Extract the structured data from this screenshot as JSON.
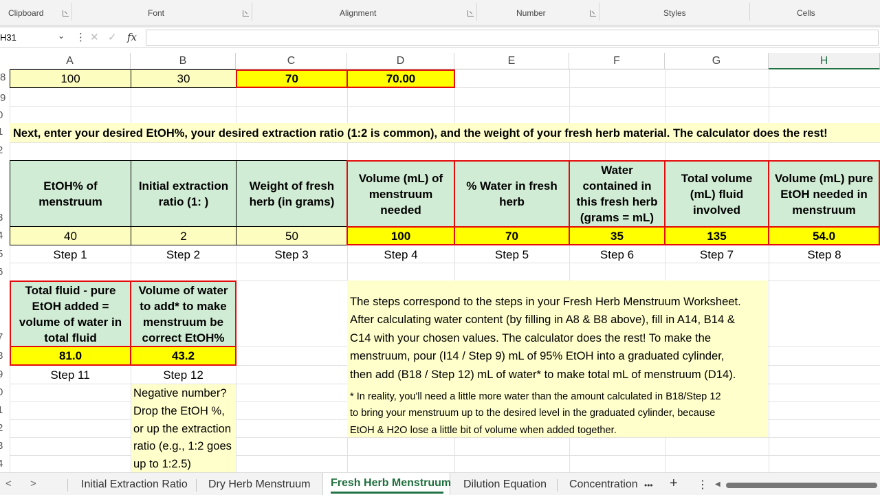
{
  "ribbon": {
    "groups": [
      "Clipboard",
      "Font",
      "Alignment",
      "Number",
      "Styles",
      "Cells"
    ]
  },
  "formula_bar": {
    "name_box": "H31",
    "fx_label": "fx",
    "cancel_glyph": "✕",
    "enter_glyph": "✓",
    "more_glyph": "⋮",
    "chevron": "⌄",
    "formula": ""
  },
  "grid": {
    "columns": [
      "A",
      "B",
      "C",
      "D",
      "E",
      "F",
      "G",
      "H"
    ],
    "selected_column": "H",
    "row_numbers": [
      "8",
      "9",
      "0",
      "1",
      "2",
      "3",
      "4",
      "5",
      "6",
      "7",
      "8",
      "9",
      "0",
      "1",
      "2",
      "3",
      "4"
    ],
    "row8": {
      "a": "100",
      "b": "30",
      "c": "70",
      "d": "70.00"
    },
    "banner": "Next, enter your desired EtOH%, your desired extraction ratio (1:2 is common),  and the weight of your fresh herb material. The calculator does the rest!",
    "headers13": [
      [
        "EtOH% of",
        "menstruum"
      ],
      [
        "Initial extraction",
        "ratio (1:  )"
      ],
      [
        "Weight of fresh",
        "herb (in grams)"
      ],
      [
        "Volume (mL) of",
        "menstruum",
        "needed"
      ],
      [
        "% Water in fresh",
        "herb"
      ],
      [
        "Water",
        "contained in",
        "this fresh herb",
        "(grams = mL)"
      ],
      [
        "Total volume",
        "(mL) fluid",
        "involved"
      ],
      [
        "Volume (mL) pure",
        "EtOH needed in",
        "menstruum"
      ]
    ],
    "values14": [
      "40",
      "2",
      "50",
      "100",
      "70",
      "35",
      "135",
      "54.0"
    ],
    "steps15": [
      "Step 1",
      "Step 2",
      "Step 3",
      "Step 4",
      "Step 5",
      "Step 6",
      "Step 7",
      "Step 8"
    ],
    "headers17": [
      [
        "Total fluid - pure",
        "EtOH added =",
        "volume of water in",
        "total fluid"
      ],
      [
        "Volume of water",
        "to add* to make",
        "menstruum be",
        "correct EtOH%"
      ]
    ],
    "values18": [
      "81.0",
      "43.2"
    ],
    "steps19": [
      "Step 11",
      "Step 12"
    ],
    "note_lines": [
      "The steps correspond to the steps in your Fresh Herb Menstruum Worksheet.",
      "After calculating water content (by filling in A8 & B8 above), fill in A14, B14 &",
      "C14 with your chosen values. The calculator does the rest! To make the",
      "menstruum, pour (I14 / Step 9) mL of 95% EtOH  into a graduated cylinder,",
      "then add (B18 / Step 12) mL of water* to make total mL of menstruum (D14)."
    ],
    "footnote_lines": [
      "* In reality, you'll need a little more water than the amount calculated in B18/Step 12",
      "to bring your menstruum up to the desired level in the graduated cylinder, because",
      "EtOH & H2O lose a little bit of volume when added together."
    ],
    "negative_lines": [
      "Negative number?",
      "Drop the EtOH %,",
      "or up the extraction",
      "ratio (e.g., 1:2 goes",
      "up to 1:2.5)"
    ]
  },
  "tabs": {
    "prev": "<",
    "next": ">",
    "items": [
      "Initial Extraction Ratio",
      "Dry Herb Menstruum",
      "Fresh Herb Menstruum",
      "Dilution Equation",
      "Concentration"
    ],
    "active": "Fresh Herb Menstruum",
    "more": "•••",
    "add": "+",
    "options": "⋮",
    "scroll_left": "◀"
  },
  "colors": {
    "light_yellow": "#fdfdbf",
    "yellow": "#ffff00",
    "green_header": "#d1ecd4",
    "red_border": "#e30b0b",
    "excel_green": "#217346"
  }
}
